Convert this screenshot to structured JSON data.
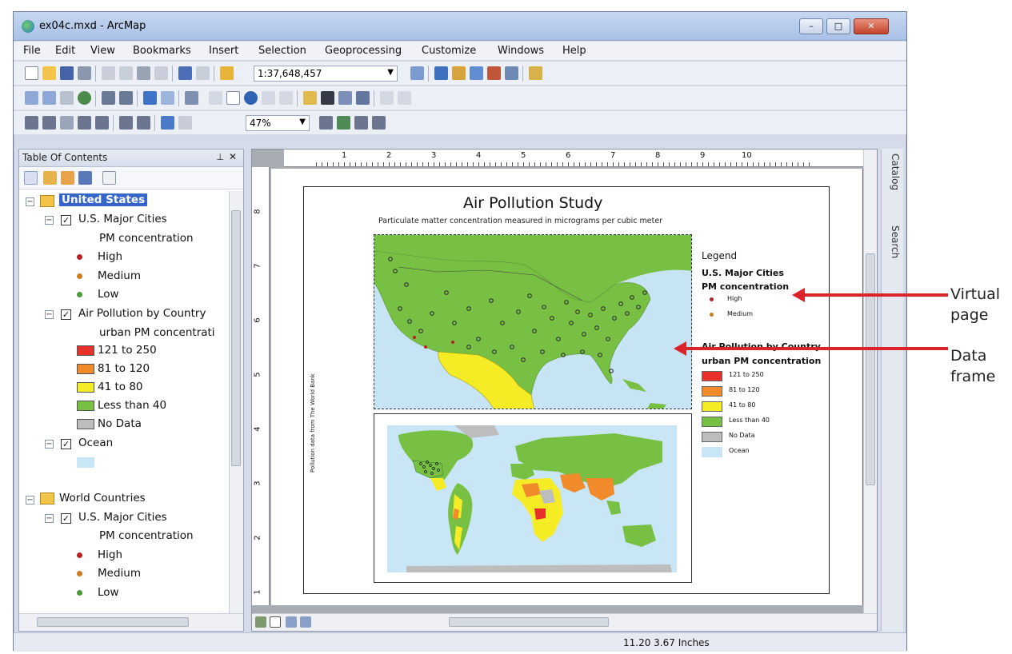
{
  "window": {
    "title": "ex04c.mxd - ArcMap"
  },
  "menu": [
    "File",
    "Edit",
    "View",
    "Bookmarks",
    "Insert",
    "Selection",
    "Geoprocessing",
    "Customize",
    "Windows",
    "Help"
  ],
  "toolbar": {
    "scale": "1:37,648,457",
    "zoom": "47%"
  },
  "toc": {
    "title": "Table Of Contents",
    "items": [
      {
        "label": "United States"
      },
      {
        "label": "U.S. Major Cities"
      },
      {
        "label": "PM concentration"
      },
      {
        "label": "High"
      },
      {
        "label": "Medium"
      },
      {
        "label": "Low"
      },
      {
        "label": "Air Pollution by Country"
      },
      {
        "label": "urban PM concentrati"
      },
      {
        "label": "121 to 250",
        "color": "#e8302a"
      },
      {
        "label": "81 to 120",
        "color": "#f08a2a"
      },
      {
        "label": "41 to 80",
        "color": "#f6ec26"
      },
      {
        "label": "Less than 40",
        "color": "#78c043"
      },
      {
        "label": "No Data",
        "color": "#bdbdbd"
      },
      {
        "label": "Ocean"
      },
      {
        "label": "World Countries"
      },
      {
        "label": "U.S. Major Cities"
      },
      {
        "label": "PM concentration"
      },
      {
        "label": "High"
      },
      {
        "label": "Medium"
      },
      {
        "label": "Low"
      }
    ],
    "ocean_color": "#c8e6f5"
  },
  "ruler": {
    "h": [
      "1",
      "2",
      "3",
      "4",
      "5",
      "6",
      "7",
      "8",
      "9",
      "10"
    ],
    "v": [
      "8",
      "7",
      "6",
      "5",
      "4",
      "3",
      "2",
      "1"
    ]
  },
  "page": {
    "title": "Air Pollution Study",
    "subtitle": "Particulate matter concentration measured in micrograms per cubic meter",
    "credit": "Pollution data from The World Bank",
    "legend": {
      "title": "Legend",
      "group1": "U.S. Major Cities",
      "group1_sub": "PM concentration",
      "high": "High",
      "medium": "Medium",
      "group2": "Air Pollution by Country",
      "group2_sub": "urban PM concentration",
      "classes": [
        {
          "label": "121 to 250",
          "color": "#e8302a"
        },
        {
          "label": "81 to 120",
          "color": "#f08a2a"
        },
        {
          "label": "41 to 80",
          "color": "#f6ec26"
        },
        {
          "label": "Less than 40",
          "color": "#78c043"
        },
        {
          "label": "No Data",
          "color": "#bdbdbd"
        },
        {
          "label": "Ocean",
          "color": "#c8e6f5"
        }
      ]
    }
  },
  "dock": {
    "catalog": "Catalog",
    "search": "Search"
  },
  "status": {
    "coords": "11.20  3.67 Inches"
  },
  "annotations": {
    "virtual_page": [
      "Virtual",
      "page"
    ],
    "data_frame": [
      "Data",
      "frame"
    ]
  }
}
